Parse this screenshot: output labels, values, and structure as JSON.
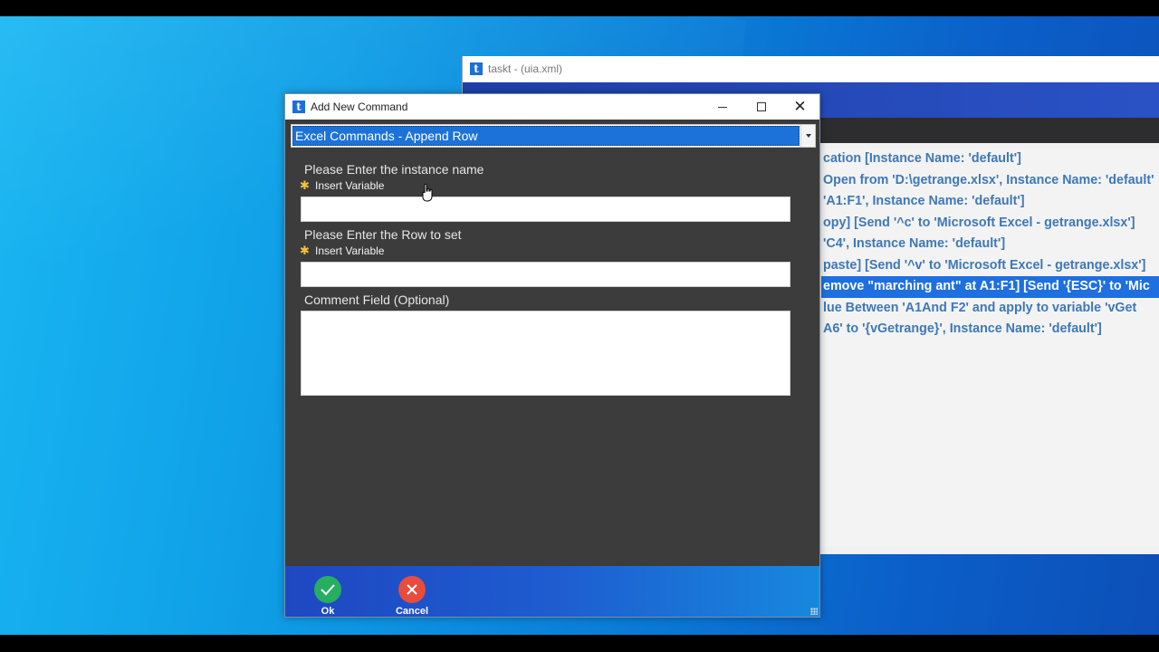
{
  "background_window": {
    "title": "taskt - (uia.xml)",
    "commands": [
      "cation [Instance Name: 'default']",
      "Open from 'D:\\getrange.xlsx', Instance Name: 'default'",
      "'A1:F1', Instance Name: 'default']",
      "opy] [Send '^c' to 'Microsoft Excel - getrange.xlsx']",
      "'C4', Instance Name: 'default']",
      "paste] [Send '^v' to 'Microsoft Excel - getrange.xlsx']",
      "emove \"marching ant\" at A1:F1] [Send '{ESC}' to 'Mic",
      "lue Between 'A1And F2' and apply to variable 'vGet",
      "A6' to '{vGetrange}', Instance Name: 'default']"
    ],
    "selected_index": 6
  },
  "dialog": {
    "title": "Add New Command",
    "command_select": {
      "selected": "Excel Commands - Append Row"
    },
    "fields": {
      "instance_label": "Please Enter the instance name",
      "instance_var": "Insert Variable",
      "instance_value": "",
      "row_label": "Please Enter the Row to set",
      "row_var": "Insert Variable",
      "row_value": "",
      "comment_label": "Comment Field (Optional)",
      "comment_value": ""
    },
    "footer": {
      "ok": "Ok",
      "cancel": "Cancel"
    }
  },
  "icons": {
    "app": "t",
    "ok": "check-icon",
    "cancel": "x-icon"
  },
  "colors": {
    "accent": "#1c72d8",
    "ok": "#27ae60",
    "cancel": "#e74c3c",
    "command_text": "#3e78b8"
  }
}
